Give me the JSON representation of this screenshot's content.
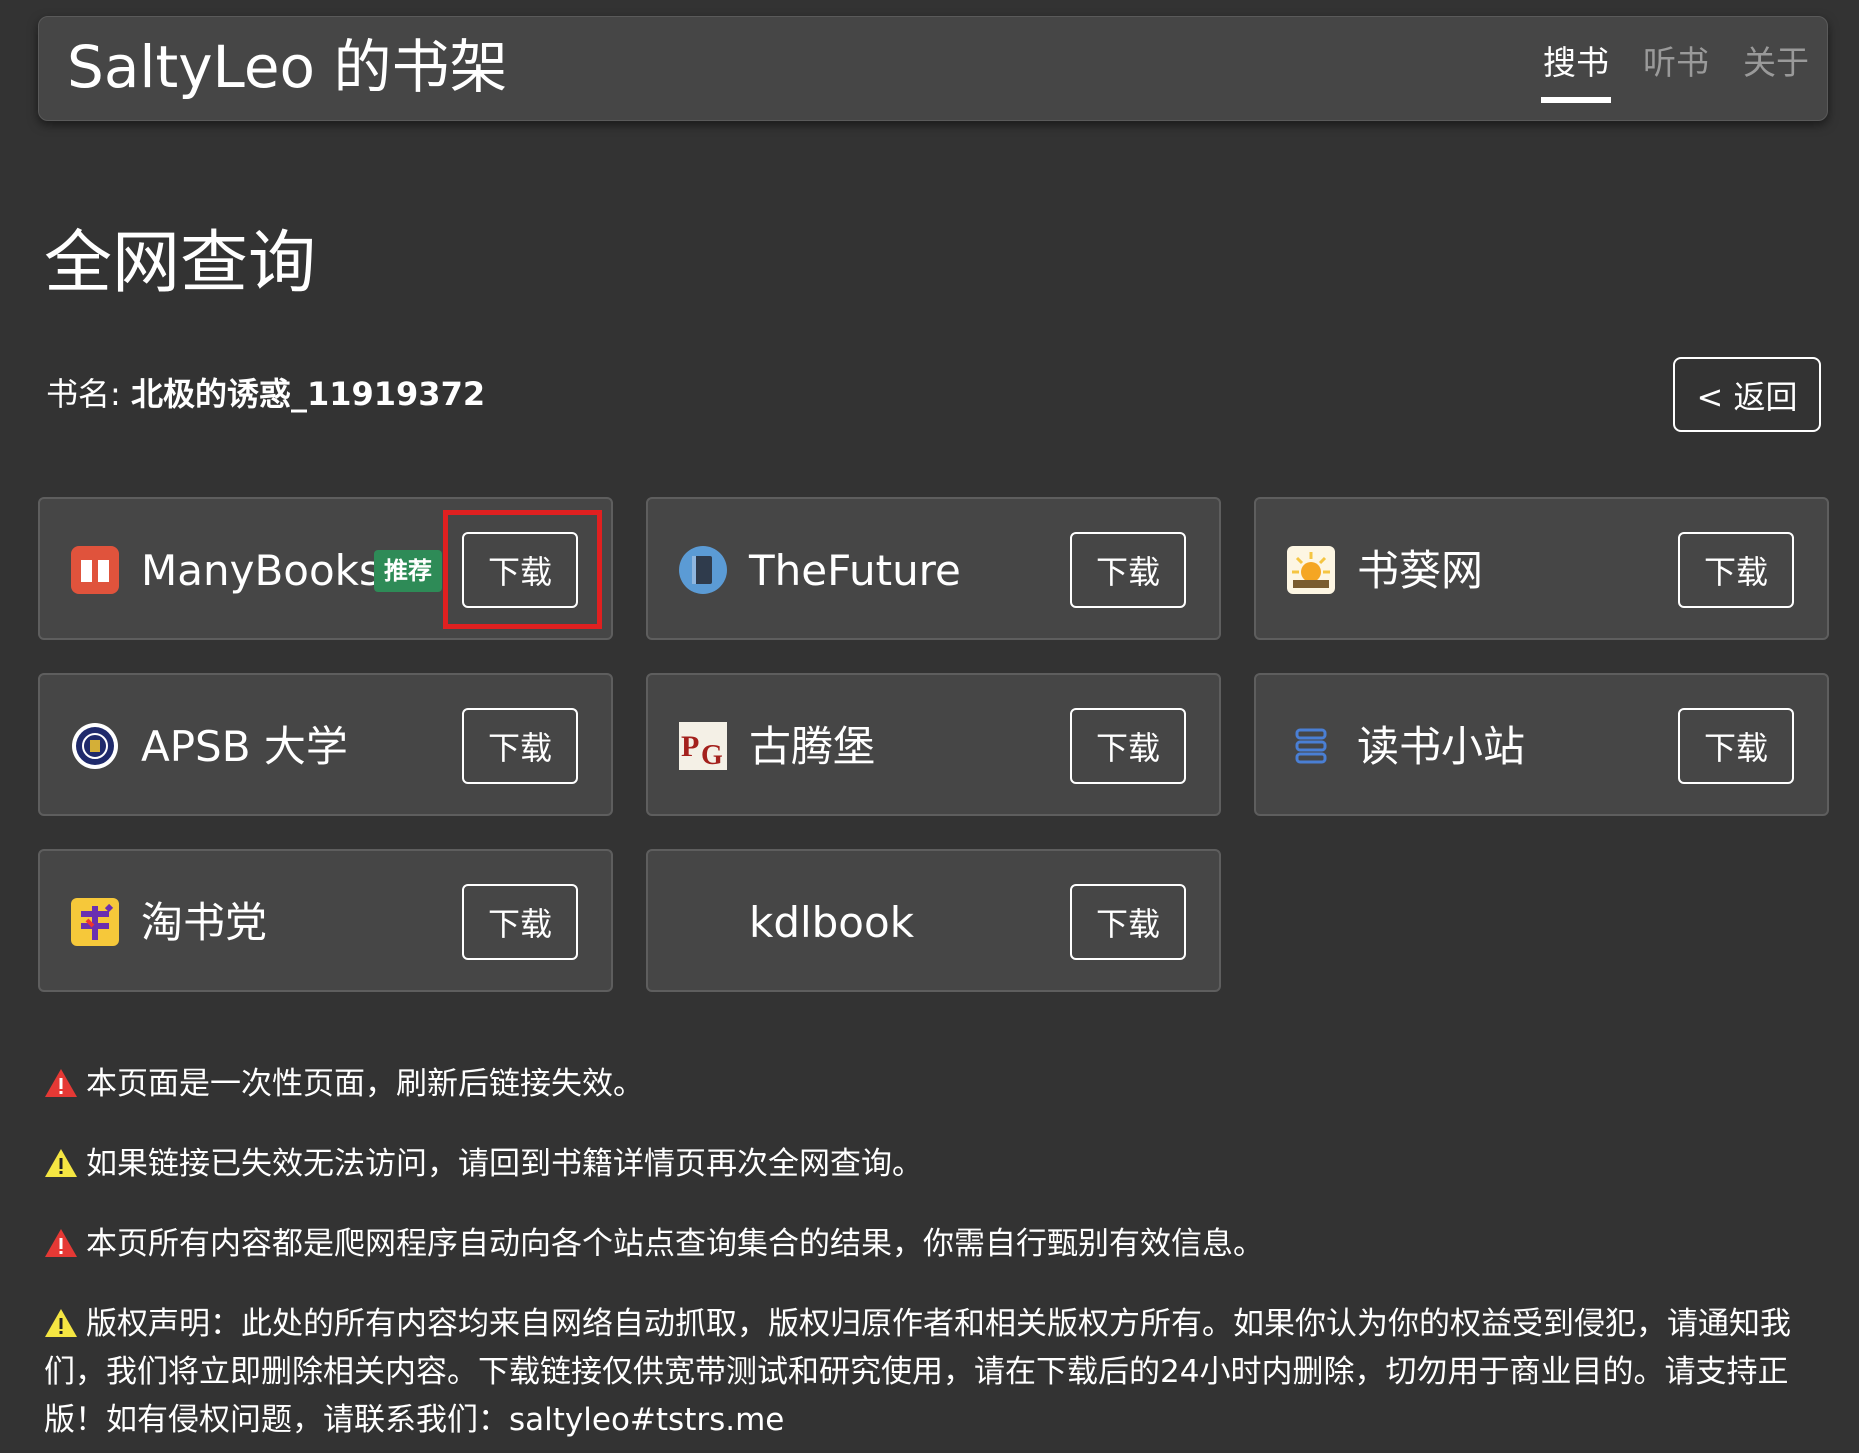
{
  "header": {
    "brand": "SaltyLeo 的书架",
    "nav": [
      {
        "label": "搜书",
        "active": true
      },
      {
        "label": "听书",
        "active": false
      },
      {
        "label": "关于",
        "active": false
      }
    ]
  },
  "main": {
    "title": "全网查询",
    "book_label": "书名:",
    "book_name": "北极的诱惑_11919372",
    "back_label": "< 返回"
  },
  "sources": [
    {
      "name": "ManyBooks",
      "badge": "推荐",
      "button": "下载",
      "icon": "book-icon",
      "highlighted": true
    },
    {
      "name": "TheFuture",
      "button": "下载",
      "icon": "notebook-icon"
    },
    {
      "name": "书葵网",
      "button": "下载",
      "icon": "sunflower-icon"
    },
    {
      "name": "APSB 大学",
      "button": "下载",
      "icon": "university-seal-icon"
    },
    {
      "name": "古腾堡",
      "button": "下载",
      "icon": "pg-logo-icon"
    },
    {
      "name": "读书小站",
      "button": "下载",
      "icon": "stack-icon"
    },
    {
      "name": "淘书党",
      "button": "下载",
      "icon": "shu-character-icon"
    },
    {
      "name": "kdlbook",
      "button": "下载",
      "icon": ""
    }
  ],
  "notices": [
    {
      "level": "red",
      "text": "本页面是一次性页面，刷新后链接失效。"
    },
    {
      "level": "yellow",
      "text": "如果链接已失效无法访问，请回到书籍详情页再次全网查询。"
    },
    {
      "level": "red",
      "text": "本页所有内容都是爬网程序自动向各个站点查询集合的结果，你需自行甄别有效信息。"
    },
    {
      "level": "yellow",
      "text": "版权声明：此处的所有内容均来自网络自动抓取，版权归原作者和相关版权方所有。如果你认为你的权益受到侵犯，请通知我们，我们将立即删除相关内容。下载链接仅供宽带测试和研究使用，请在下载后的24小时内删除，切勿用于商业目的。请支持正版！如有侵权问题，请联系我们：saltyleo#tstrs.me"
    }
  ],
  "colors": {
    "background": "#333333",
    "card": "#464646",
    "badge": "#2e8b57",
    "highlight": "#e02020",
    "warn_red": "#e53935",
    "warn_yellow": "#f5e642"
  }
}
